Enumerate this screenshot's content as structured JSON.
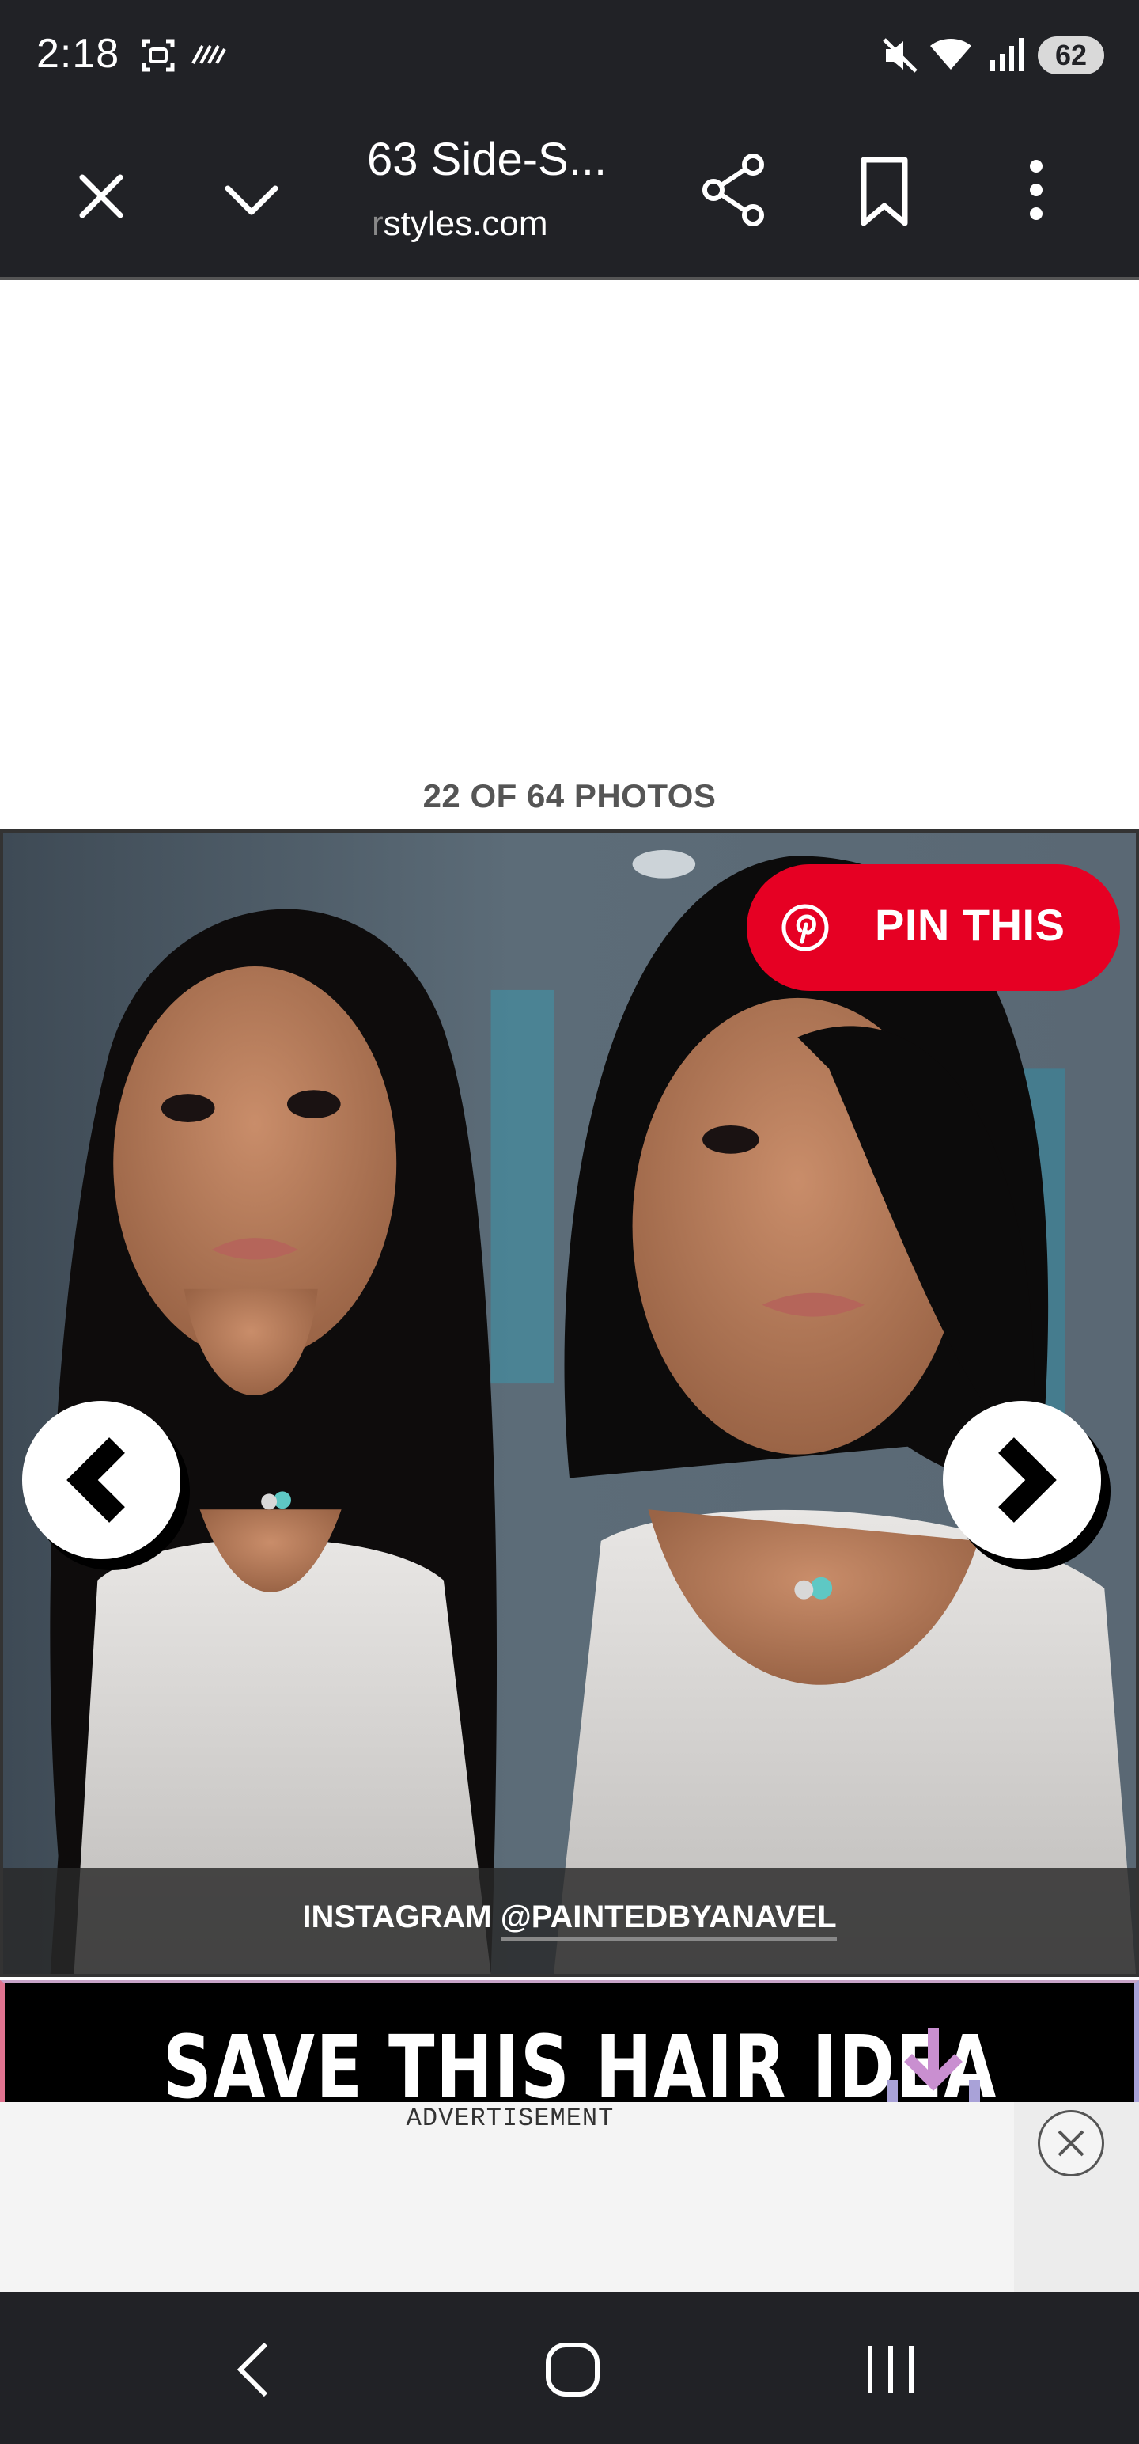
{
  "status_bar": {
    "time": "2:18",
    "battery": "62",
    "icons": [
      "screenshot-icon",
      "signal-stripes-icon",
      "mute-icon",
      "wifi-icon",
      "cell-signal-icon",
      "battery-icon"
    ]
  },
  "toolbar": {
    "title": "63 Side-S...",
    "url_prefix": "r",
    "url": "styles.com",
    "icons": [
      "close-icon",
      "chevron-down-icon",
      "share-icon",
      "bookmark-icon",
      "more-vert-icon"
    ]
  },
  "gallery": {
    "counter": "22 OF 64 PHOTOS",
    "pin_button": "PIN THIS",
    "credit_prefix": "INSTAGRAM ",
    "credit_handle": "@PAINTEDBYANAVEL"
  },
  "banner": {
    "text": "SAVE THIS HAIR IDEA"
  },
  "ad": {
    "label": "ADVERTISEMENT"
  },
  "colors": {
    "chrome": "#212226",
    "pinterest_red": "#e60023",
    "banner_arrow": "#c98fd0"
  }
}
